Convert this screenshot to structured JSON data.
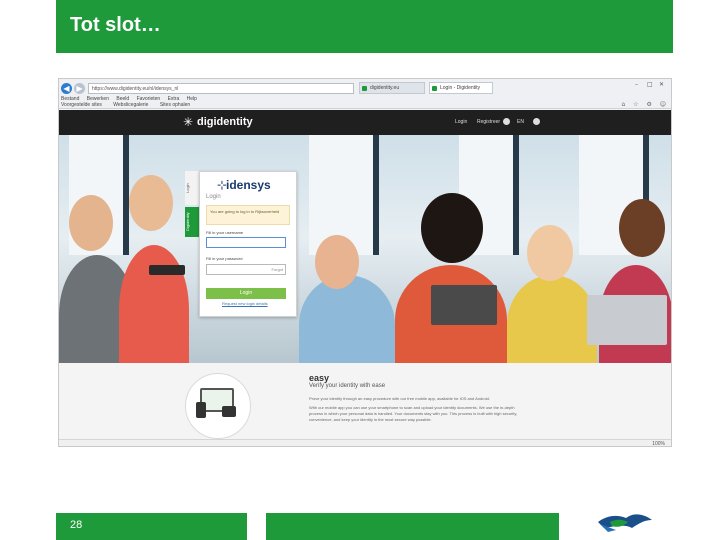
{
  "slide": {
    "title": "Tot slot…",
    "page_number": "28"
  },
  "browser": {
    "address": "https://www.digidentity.eu/nl/idensys_nl",
    "tabs": [
      {
        "label": "digidentity.eu"
      },
      {
        "label": "Login - Digidentity"
      }
    ],
    "menu": [
      "Bestand",
      "Bewerken",
      "Beeld",
      "Favorieten",
      "Extra",
      "Help"
    ],
    "favorites": [
      "Voorgestelde sites",
      "Webslicegalerie",
      "Sites ophalen"
    ],
    "zoom": "100%"
  },
  "site": {
    "logo": "digidentity",
    "nav": [
      "Login",
      "Registreer",
      "EN"
    ]
  },
  "login": {
    "brand": "idensys",
    "side_tab": "Digidentity",
    "top_tab": "Login",
    "title": "Login",
    "notice": "You are going to log in to Rijksoverheid",
    "username_label": "Fill in your username",
    "password_label": "Fill in your password",
    "password_hint": "Forgot",
    "button": "Login",
    "forgot_link": "Request new login details"
  },
  "lower": {
    "title": "easy",
    "subtitle": "Verify your identity with ease",
    "paragraphs": [
      "Prove your identity through an easy procedure with our free mobile app, available for iOS and Android.",
      "With our mobile app you can use your smartphone to scan and upload your identity documents. We use the in-depth",
      "process in which your personal data is handled. Your documents stay with you. This process is built with high security,",
      "convenience, and keep your identity in the most secure way possible."
    ]
  },
  "colors": {
    "green": "#1e9a3a",
    "header_dark": "#1f1f1f",
    "login_button": "#7cc04a"
  }
}
